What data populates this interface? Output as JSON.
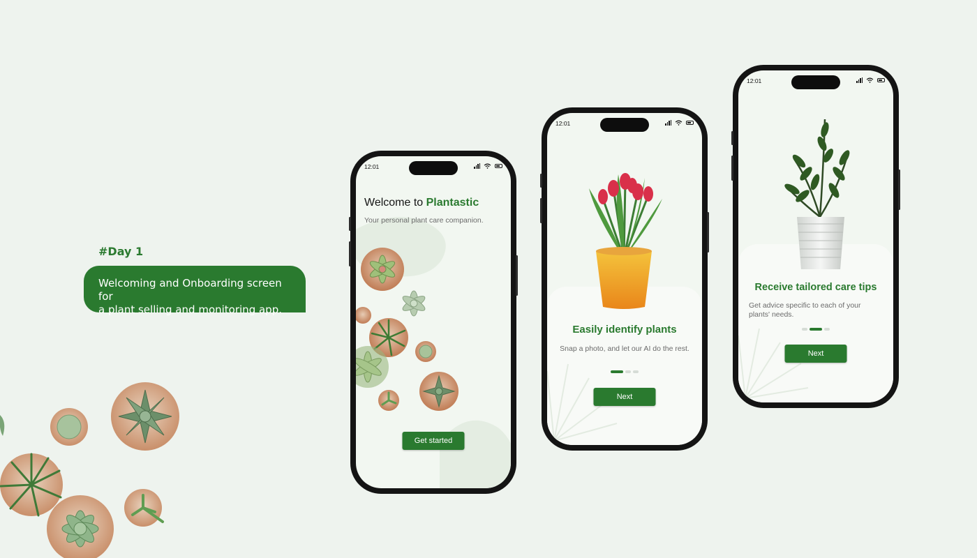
{
  "caption": {
    "tag": "#Day 1",
    "lines": [
      "Welcoming and Onboarding screen for",
      "a plant selling and monitoring app."
    ]
  },
  "colors": {
    "brand": "#2a7a2f",
    "background": "#eef3ee"
  },
  "status_bar": {
    "time": "12:01"
  },
  "screen1": {
    "title_prefix": "Welcome to ",
    "title_brand": "Plantastic",
    "subtitle": "Your personal plant care companion.",
    "button": "Get started"
  },
  "screen2": {
    "title": "Easily identify plants",
    "subtitle": "Snap a photo, and let our AI do the rest.",
    "button": "Next",
    "active_page": 1,
    "page_count": 3
  },
  "screen3": {
    "title": "Receive tailored care tips",
    "subtitle_line1": "Get advice specific to each of your",
    "subtitle_line2": "plants' needs.",
    "button": "Next",
    "active_page": 2,
    "page_count": 3
  }
}
